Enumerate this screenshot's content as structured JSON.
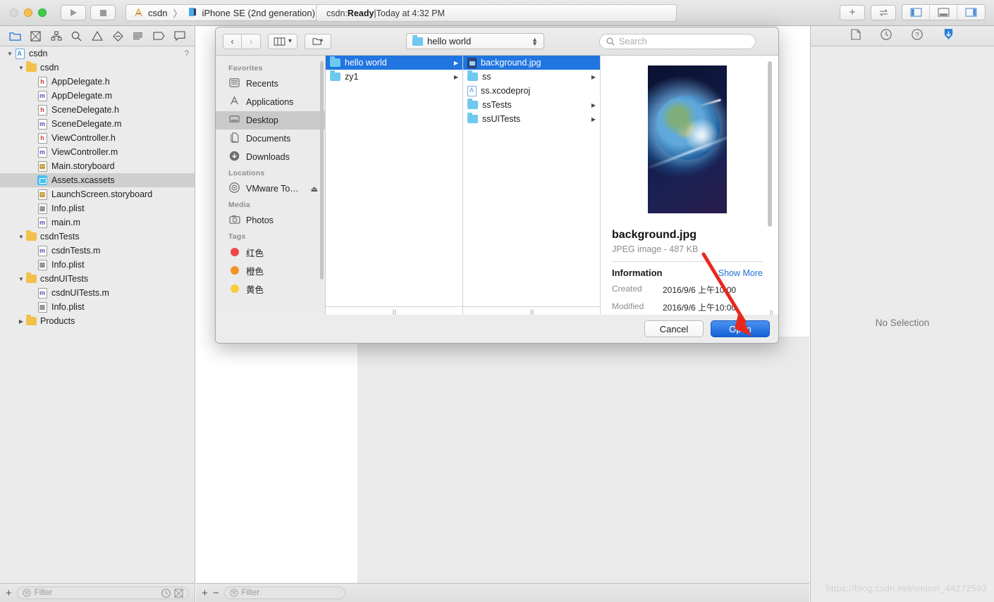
{
  "window": {
    "title": "csdn",
    "scheme": {
      "project": "csdn",
      "separator": "〉",
      "destination": "iPhone SE (2nd generation)"
    },
    "status": {
      "prefix": "csdn: ",
      "state": "Ready",
      "divider": " | ",
      "time": "Today at 4:32 PM"
    },
    "traffic": {
      "close": "close-button",
      "minimize": "minimize-button",
      "maximize": "maximize-button"
    },
    "run_button": "run-button",
    "stop_button": "stop-button",
    "add_button": "+",
    "toggle_button": "⇄",
    "panes": [
      "navigator-toggle",
      "debug-toggle",
      "inspector-toggle"
    ]
  },
  "navigator": {
    "toolbar_icons": [
      "folder-icon",
      "source-control-icon",
      "symbol-icon",
      "search-icon",
      "warning-icon",
      "test-icon",
      "debug-icon",
      "breakpoint-icon",
      "report-icon"
    ],
    "help_hint": "?",
    "items": [
      {
        "label": "csdn",
        "indent": 0,
        "twist": "▼",
        "icon": "project-icon",
        "selected": false
      },
      {
        "label": "csdn",
        "indent": 1,
        "twist": "▼",
        "icon": "folder-icon",
        "selected": false
      },
      {
        "label": "AppDelegate.h",
        "indent": 2,
        "twist": "",
        "icon": "header-file-icon",
        "selected": false
      },
      {
        "label": "AppDelegate.m",
        "indent": 2,
        "twist": "",
        "icon": "objc-file-icon",
        "selected": false
      },
      {
        "label": "SceneDelegate.h",
        "indent": 2,
        "twist": "",
        "icon": "header-file-icon",
        "selected": false
      },
      {
        "label": "SceneDelegate.m",
        "indent": 2,
        "twist": "",
        "icon": "objc-file-icon",
        "selected": false
      },
      {
        "label": "ViewController.h",
        "indent": 2,
        "twist": "",
        "icon": "header-file-icon",
        "selected": false
      },
      {
        "label": "ViewController.m",
        "indent": 2,
        "twist": "",
        "icon": "objc-file-icon",
        "selected": false
      },
      {
        "label": "Main.storyboard",
        "indent": 2,
        "twist": "",
        "icon": "storyboard-icon",
        "selected": false
      },
      {
        "label": "Assets.xcassets",
        "indent": 2,
        "twist": "",
        "icon": "xcassets-icon",
        "selected": true
      },
      {
        "label": "LaunchScreen.storyboard",
        "indent": 2,
        "twist": "",
        "icon": "storyboard-icon",
        "selected": false
      },
      {
        "label": "Info.plist",
        "indent": 2,
        "twist": "",
        "icon": "plist-icon",
        "selected": false
      },
      {
        "label": "main.m",
        "indent": 2,
        "twist": "",
        "icon": "objc-file-icon",
        "selected": false
      },
      {
        "label": "csdnTests",
        "indent": 1,
        "twist": "▼",
        "icon": "folder-icon",
        "selected": false
      },
      {
        "label": "csdnTests.m",
        "indent": 2,
        "twist": "",
        "icon": "objc-file-icon",
        "selected": false
      },
      {
        "label": "Info.plist",
        "indent": 2,
        "twist": "",
        "icon": "plist-icon",
        "selected": false
      },
      {
        "label": "csdnUITests",
        "indent": 1,
        "twist": "▼",
        "icon": "folder-icon",
        "selected": false
      },
      {
        "label": "csdnUITests.m",
        "indent": 2,
        "twist": "",
        "icon": "objc-file-icon",
        "selected": false
      },
      {
        "label": "Info.plist",
        "indent": 2,
        "twist": "",
        "icon": "plist-icon",
        "selected": false
      },
      {
        "label": "Products",
        "indent": 1,
        "twist": "▶",
        "icon": "folder-icon",
        "selected": false
      }
    ],
    "footer": {
      "add": "+",
      "filter_placeholder": "Filter",
      "recent_icon": "clock-icon",
      "source_icon": "source-control-filter-icon"
    }
  },
  "editor": {
    "footer": {
      "add": "+",
      "remove": "−",
      "filter_placeholder": "Filter"
    }
  },
  "inspector": {
    "toolbar_icons": [
      "file-inspector-icon",
      "history-inspector-icon",
      "quick-help-icon",
      "library-icon"
    ],
    "empty_state": "No Selection"
  },
  "open_panel": {
    "toolbar": {
      "back": "‹",
      "forward": "›",
      "view_mode": "column-view",
      "new_folder": "new-folder-icon",
      "path_label": "hello world",
      "search_placeholder": "Search"
    },
    "sidebar": {
      "sections": [
        {
          "title": "Favorites",
          "items": [
            {
              "label": "Recents",
              "icon": "recents-icon",
              "selected": false
            },
            {
              "label": "Applications",
              "icon": "applications-icon",
              "selected": false
            },
            {
              "label": "Desktop",
              "icon": "desktop-icon",
              "selected": true
            },
            {
              "label": "Documents",
              "icon": "documents-icon",
              "selected": false
            },
            {
              "label": "Downloads",
              "icon": "downloads-icon",
              "selected": false
            }
          ]
        },
        {
          "title": "Locations",
          "items": [
            {
              "label": "VMware To…",
              "icon": "disc-icon",
              "selected": false,
              "eject": "⏏"
            }
          ]
        },
        {
          "title": "Media",
          "items": [
            {
              "label": "Photos",
              "icon": "camera-icon",
              "selected": false
            }
          ]
        },
        {
          "title": "Tags",
          "items": [
            {
              "label": "红色",
              "icon": "tag-dot",
              "color": "#f0484a",
              "selected": false
            },
            {
              "label": "橙色",
              "icon": "tag-dot",
              "color": "#f19426",
              "selected": false
            },
            {
              "label": "黄色",
              "icon": "tag-dot",
              "color": "#f7ce3c",
              "selected": false
            }
          ]
        }
      ]
    },
    "columns": [
      {
        "items": [
          {
            "label": "hello world",
            "icon": "folder-icon",
            "has_children": true,
            "selected": true
          },
          {
            "label": "zy1",
            "icon": "folder-icon",
            "has_children": true,
            "selected": false
          }
        ]
      },
      {
        "items": [
          {
            "label": "background.jpg",
            "icon": "jpeg-icon",
            "has_children": false,
            "selected": true
          },
          {
            "label": "ss",
            "icon": "folder-icon",
            "has_children": true,
            "selected": false
          },
          {
            "label": "ss.xcodeproj",
            "icon": "xcodeproj-icon",
            "has_children": false,
            "selected": false
          },
          {
            "label": "ssTests",
            "icon": "folder-icon",
            "has_children": true,
            "selected": false
          },
          {
            "label": "ssUITests",
            "icon": "folder-icon",
            "has_children": true,
            "selected": false
          }
        ]
      }
    ],
    "preview": {
      "image_alt": "earth-from-space-preview",
      "name": "background.jpg",
      "kind": "JPEG image - 487 KB",
      "info_title": "Information",
      "show_more": "Show More",
      "rows": [
        {
          "key": "Created",
          "value": "2016/9/6 上午10:00"
        },
        {
          "key": "Modified",
          "value": "2016/9/6 上午10:00"
        }
      ]
    },
    "footer": {
      "cancel": "Cancel",
      "open": "Open"
    }
  },
  "annotation": {
    "arrow": "red-arrow-pointing-to-open-button",
    "color": "#e8281e"
  },
  "watermark": "https://blog.csdn.net/weixin_44272593",
  "colors": {
    "accent": "#1562d8",
    "selection": "#2175e0",
    "link": "#2272d4"
  }
}
